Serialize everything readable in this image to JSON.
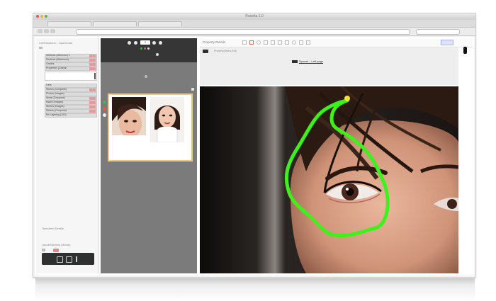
{
  "browser": {
    "window_title": "Rosetta 1.0",
    "tabs": [
      "",
      "",
      ""
    ],
    "url": ""
  },
  "left_panel": {
    "heading": "Contributions – Spaceman",
    "rows": [
      "Sections (Minimum) 1",
      "Sections (Maximum)",
      "Grades",
      "Properties (Global)",
      "",
      "",
      "Cells",
      "Stories (Complete)",
      "Photos (Images)",
      "Items (Compose)",
      "Match (Images)",
      "Stories (Images)",
      "Stories (Compose)",
      "Re-Layering (GUI)"
    ],
    "footer_label": "Tearsheet Details",
    "footer_sub": "Layout/Elements (Mosaic)"
  },
  "middle_panel": {
    "top_label": "",
    "page_number": "1"
  },
  "right_panel": {
    "header_title": "Property Details",
    "toolbar_caption": "Property/Style ▸ Edit",
    "toolbar_center": "Spread – Left page"
  },
  "colors": {
    "accent_swatch": "#e89a9a",
    "page_border": "#e7c98a",
    "annotation": "#3df21a",
    "annotation_end": "#f1e52a"
  }
}
